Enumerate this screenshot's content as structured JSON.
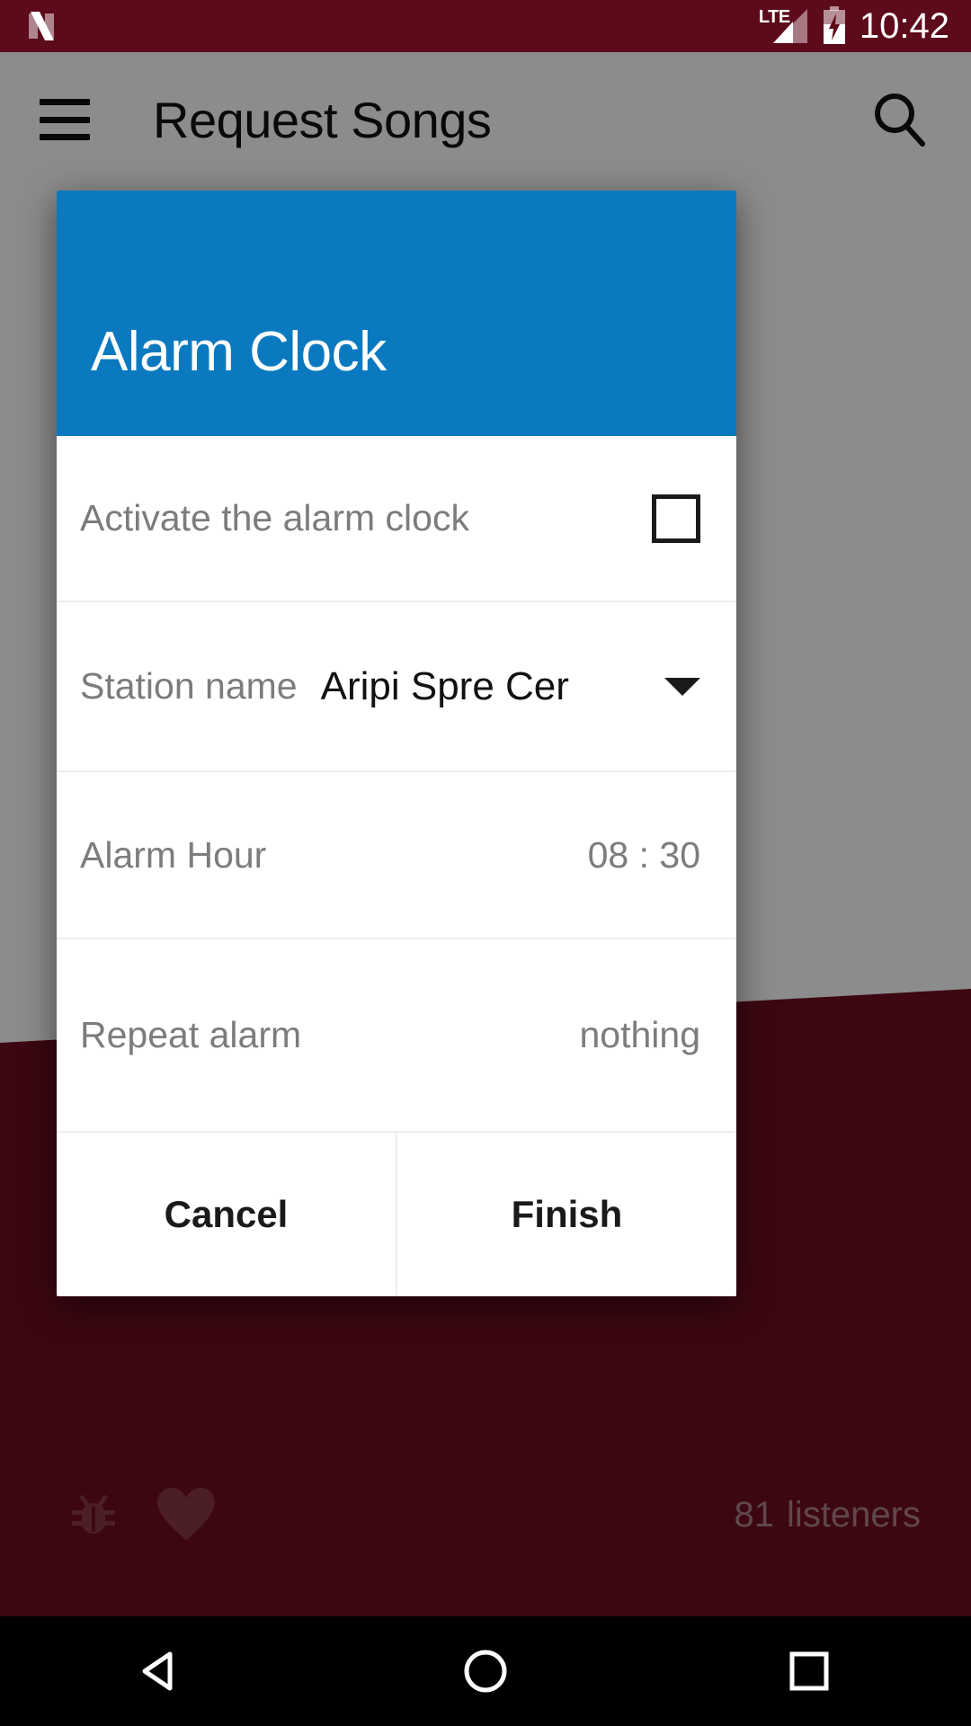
{
  "status_bar": {
    "logo_icon": "android-n-logo-icon",
    "network_label": "LTE",
    "signal_icon": "signal-bars-icon",
    "battery_icon": "battery-charging-icon",
    "time": "10:42",
    "background_color": "#5d0a1a"
  },
  "app_bar": {
    "menu_icon": "hamburger-menu-icon",
    "title": "Request Songs",
    "search_icon": "search-icon"
  },
  "app_background": {
    "bug_icon": "bug-report-icon",
    "favorite_icon": "heart-icon",
    "listeners_count": "81",
    "listeners_label": "listeners",
    "accent_color": "#6d0d20"
  },
  "dialog": {
    "title": "Alarm Clock",
    "header_color": "#0b79bf",
    "rows": [
      {
        "label": "Activate the alarm clock",
        "control": "checkbox",
        "checked": false
      },
      {
        "label": "Station name",
        "value": "Aripi Spre Cer",
        "control": "dropdown"
      },
      {
        "label": "Alarm Hour",
        "value": "08 : 30",
        "control": "time"
      },
      {
        "label": "Repeat alarm",
        "value": "nothing",
        "control": "text"
      }
    ],
    "cancel_label": "Cancel",
    "finish_label": "Finish"
  },
  "nav_bar": {
    "back_icon": "back-triangle-icon",
    "home_icon": "home-circle-icon",
    "recents_icon": "recents-square-icon"
  }
}
